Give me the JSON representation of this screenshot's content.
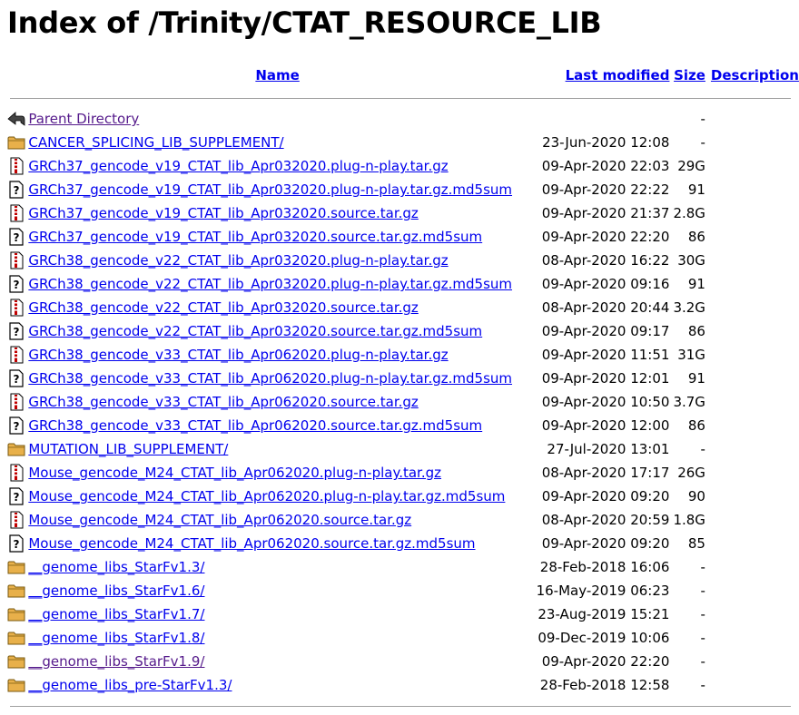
{
  "title": "Index of /Trinity/CTAT_RESOURCE_LIB",
  "headers": {
    "name": "Name",
    "modified": "Last modified",
    "size": "Size",
    "description": "Description"
  },
  "rows": [
    {
      "icon": "back-icon",
      "name": "Parent Directory",
      "modified": "",
      "size": "-",
      "visited": true
    },
    {
      "icon": "folder-icon",
      "name": "CANCER_SPLICING_LIB_SUPPLEMENT/",
      "modified": "23-Jun-2020 12:08",
      "size": "-"
    },
    {
      "icon": "compressed-file-icon",
      "name": "GRCh37_gencode_v19_CTAT_lib_Apr032020.plug-n-play.tar.gz",
      "modified": "09-Apr-2020 22:03",
      "size": "29G"
    },
    {
      "icon": "unknown-file-icon",
      "name": "GRCh37_gencode_v19_CTAT_lib_Apr032020.plug-n-play.tar.gz.md5sum",
      "modified": "09-Apr-2020 22:22",
      "size": "91"
    },
    {
      "icon": "compressed-file-icon",
      "name": "GRCh37_gencode_v19_CTAT_lib_Apr032020.source.tar.gz",
      "modified": "09-Apr-2020 21:37",
      "size": "2.8G"
    },
    {
      "icon": "unknown-file-icon",
      "name": "GRCh37_gencode_v19_CTAT_lib_Apr032020.source.tar.gz.md5sum",
      "modified": "09-Apr-2020 22:20",
      "size": "86"
    },
    {
      "icon": "compressed-file-icon",
      "name": "GRCh38_gencode_v22_CTAT_lib_Apr032020.plug-n-play.tar.gz",
      "modified": "08-Apr-2020 16:22",
      "size": "30G"
    },
    {
      "icon": "unknown-file-icon",
      "name": "GRCh38_gencode_v22_CTAT_lib_Apr032020.plug-n-play.tar.gz.md5sum",
      "modified": "09-Apr-2020 09:16",
      "size": "91"
    },
    {
      "icon": "compressed-file-icon",
      "name": "GRCh38_gencode_v22_CTAT_lib_Apr032020.source.tar.gz",
      "modified": "08-Apr-2020 20:44",
      "size": "3.2G"
    },
    {
      "icon": "unknown-file-icon",
      "name": "GRCh38_gencode_v22_CTAT_lib_Apr032020.source.tar.gz.md5sum",
      "modified": "09-Apr-2020 09:17",
      "size": "86"
    },
    {
      "icon": "compressed-file-icon",
      "name": "GRCh38_gencode_v33_CTAT_lib_Apr062020.plug-n-play.tar.gz",
      "modified": "09-Apr-2020 11:51",
      "size": "31G"
    },
    {
      "icon": "unknown-file-icon",
      "name": "GRCh38_gencode_v33_CTAT_lib_Apr062020.plug-n-play.tar.gz.md5sum",
      "modified": "09-Apr-2020 12:01",
      "size": "91"
    },
    {
      "icon": "compressed-file-icon",
      "name": "GRCh38_gencode_v33_CTAT_lib_Apr062020.source.tar.gz",
      "modified": "09-Apr-2020 10:50",
      "size": "3.7G"
    },
    {
      "icon": "unknown-file-icon",
      "name": "GRCh38_gencode_v33_CTAT_lib_Apr062020.source.tar.gz.md5sum",
      "modified": "09-Apr-2020 12:00",
      "size": "86"
    },
    {
      "icon": "folder-icon",
      "name": "MUTATION_LIB_SUPPLEMENT/",
      "modified": "27-Jul-2020 13:01",
      "size": "-"
    },
    {
      "icon": "compressed-file-icon",
      "name": "Mouse_gencode_M24_CTAT_lib_Apr062020.plug-n-play.tar.gz",
      "modified": "08-Apr-2020 17:17",
      "size": "26G"
    },
    {
      "icon": "unknown-file-icon",
      "name": "Mouse_gencode_M24_CTAT_lib_Apr062020.plug-n-play.tar.gz.md5sum",
      "modified": "09-Apr-2020 09:20",
      "size": "90"
    },
    {
      "icon": "compressed-file-icon",
      "name": "Mouse_gencode_M24_CTAT_lib_Apr062020.source.tar.gz",
      "modified": "08-Apr-2020 20:59",
      "size": "1.8G"
    },
    {
      "icon": "unknown-file-icon",
      "name": "Mouse_gencode_M24_CTAT_lib_Apr062020.source.tar.gz.md5sum",
      "modified": "09-Apr-2020 09:20",
      "size": "85"
    },
    {
      "icon": "folder-icon",
      "name": "__genome_libs_StarFv1.3/",
      "modified": "28-Feb-2018 16:06",
      "size": "-"
    },
    {
      "icon": "folder-icon",
      "name": "__genome_libs_StarFv1.6/",
      "modified": "16-May-2019 06:23",
      "size": "-"
    },
    {
      "icon": "folder-icon",
      "name": "__genome_libs_StarFv1.7/",
      "modified": "23-Aug-2019 15:21",
      "size": "-"
    },
    {
      "icon": "folder-icon",
      "name": "__genome_libs_StarFv1.8/",
      "modified": "09-Dec-2019 10:06",
      "size": "-"
    },
    {
      "icon": "folder-icon",
      "name": "__genome_libs_StarFv1.9/",
      "modified": "09-Apr-2020 22:20",
      "size": "-",
      "visited": true
    },
    {
      "icon": "folder-icon",
      "name": "__genome_libs_pre-StarFv1.3/",
      "modified": "28-Feb-2018 12:58",
      "size": "-"
    }
  ],
  "colors": {
    "link": "#0000ee",
    "visited": "#551a8b",
    "folder": "#e8b04a",
    "rule": "#a0a0a0"
  }
}
